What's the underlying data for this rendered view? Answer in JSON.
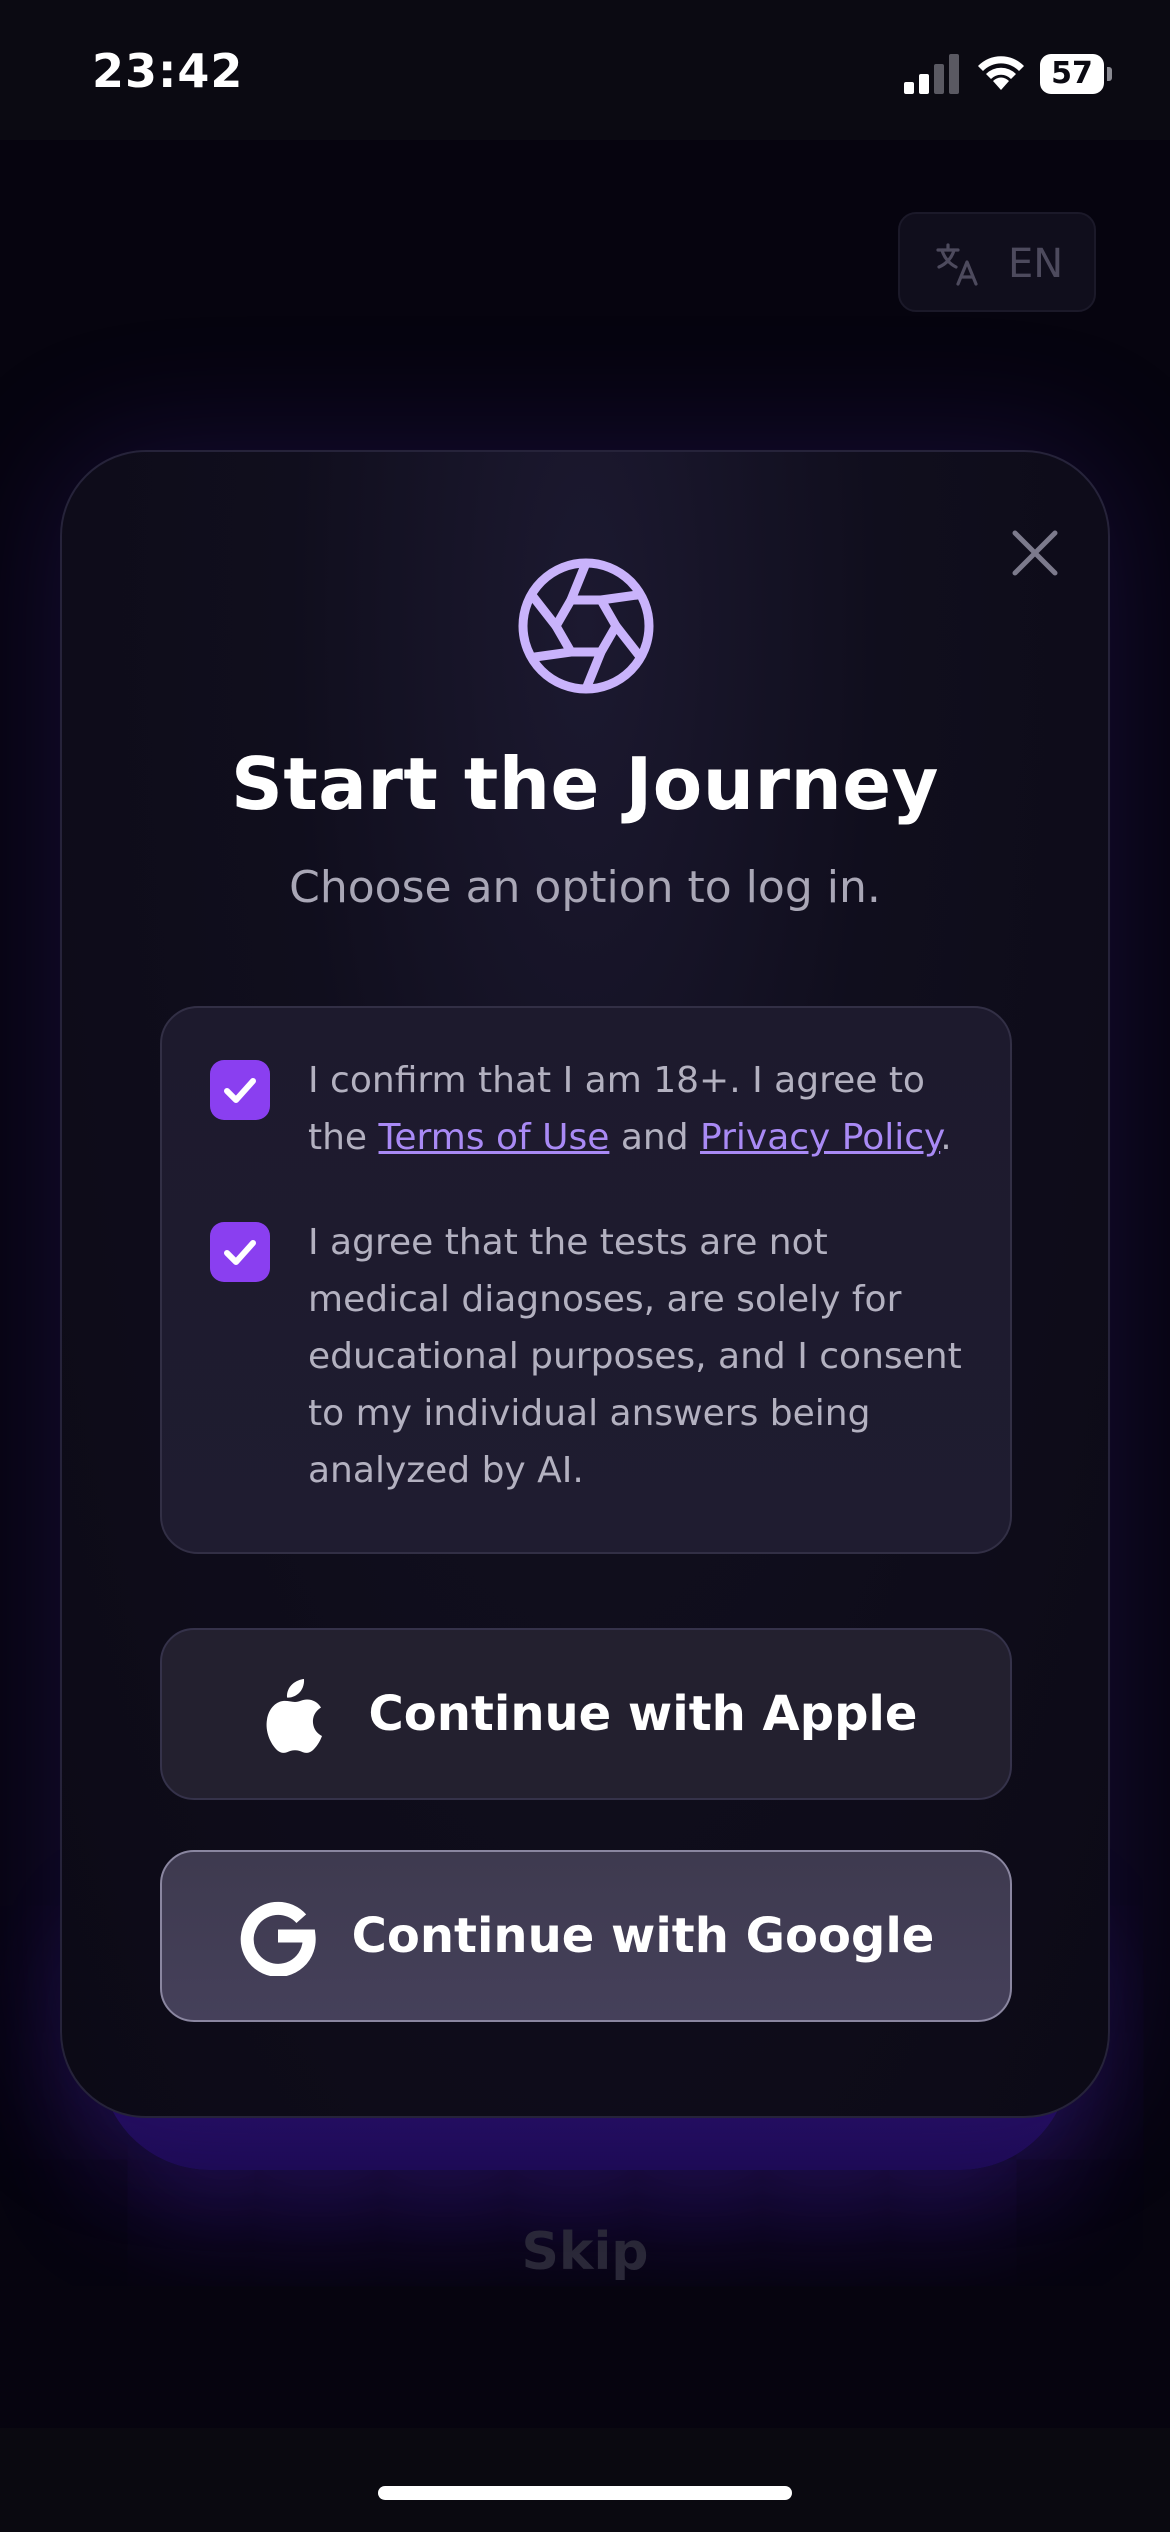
{
  "status_bar": {
    "time": "23:42",
    "battery_level": "57"
  },
  "language": {
    "label": "EN",
    "icon": "translate-icon"
  },
  "modal": {
    "title": "Start the Journey",
    "subtitle": "Choose an option to log in.",
    "icon": "aperture-icon",
    "close_icon": "close-icon",
    "consents": [
      {
        "checked": true,
        "text_before": "I confirm that I am 18+. I agree to the ",
        "link1": "Terms of Use",
        "text_middle": " and ",
        "link2": "Privacy Policy",
        "text_after": "."
      },
      {
        "checked": true,
        "text": "I agree that the tests are not medical diagnoses, are solely for educational purposes, and I consent to my individual answers being analyzed by AI."
      }
    ],
    "buttons": {
      "apple_label": "Continue with Apple",
      "google_label": "Continue with Google"
    }
  },
  "skip_label": "Skip",
  "colors": {
    "accent": "#8a3ff0",
    "link": "#a98af5",
    "background": "#06040f"
  }
}
